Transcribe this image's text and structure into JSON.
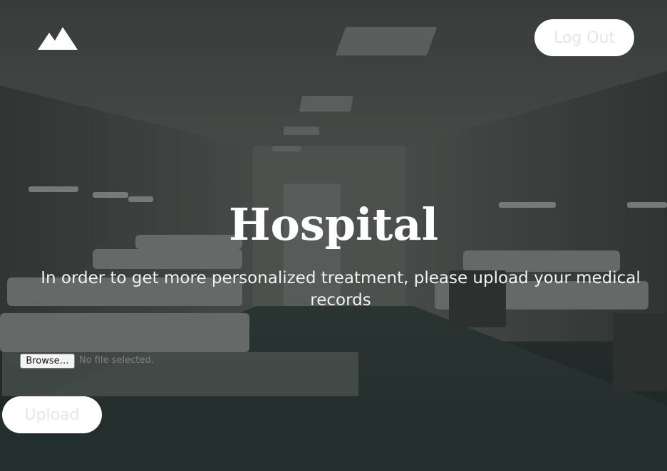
{
  "header": {
    "logo_icon": "mountain-icon",
    "logout_label": "Log Out"
  },
  "hero": {
    "title": "Hospital",
    "subtitle": "In order to get more personalized treatment, please upload your medical records"
  },
  "upload_form": {
    "browse_label": "Browse…",
    "file_status": "No file selected.",
    "upload_label": "Upload"
  },
  "colors": {
    "button_bg": "#ffffff",
    "button_text": "#e6e6e6",
    "title_text": "#ffffff"
  }
}
